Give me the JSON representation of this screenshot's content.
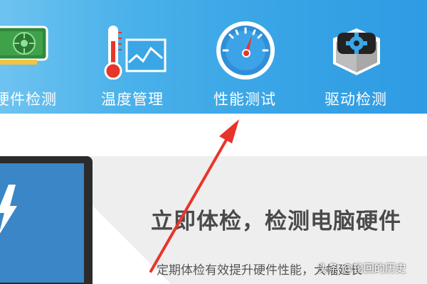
{
  "toolbar": {
    "items": [
      {
        "label": "硬件检测",
        "icon": "graphics-card-icon"
      },
      {
        "label": "温度管理",
        "icon": "thermometer-icon"
      },
      {
        "label": "性能测试",
        "icon": "speedometer-icon"
      },
      {
        "label": "驱动检测",
        "icon": "gear-cube-icon"
      }
    ]
  },
  "main": {
    "headline": "立即体检，检测电脑硬件",
    "subline": "定期体检有效提升硬件性能，大幅延长"
  },
  "watermark": "头条 @轮回的历史",
  "colors": {
    "toolbar_start": "#6ec3f0",
    "toolbar_end": "#2e9be3",
    "annotation_arrow": "#e8352b",
    "headline": "#4a4a4a"
  }
}
